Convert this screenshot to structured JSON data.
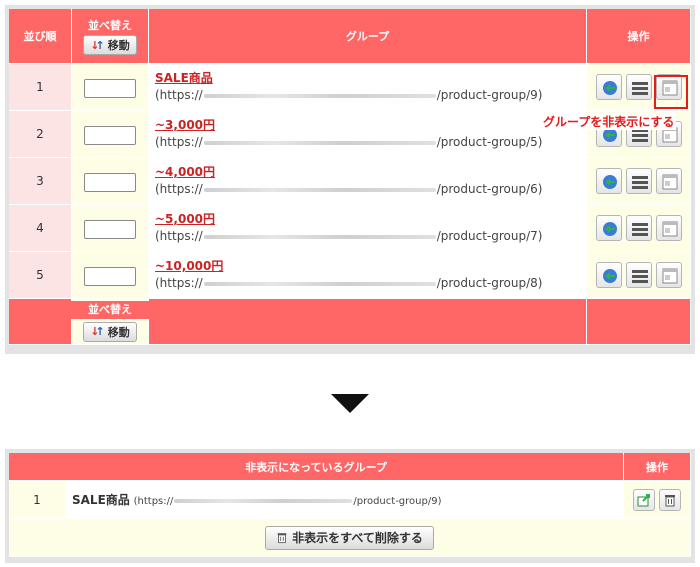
{
  "top_table": {
    "headers": {
      "order": "並び順",
      "sort": "並べ替え",
      "group": "グループ",
      "actions": "操作"
    },
    "move_button_label": "移動",
    "rows": [
      {
        "num": "1",
        "name": "SALE商品",
        "url_prefix": "(https://",
        "url_suffix": "/product-group/9)"
      },
      {
        "num": "2",
        "name": "~3,000円",
        "url_prefix": "(https://",
        "url_suffix": "/product-group/5)"
      },
      {
        "num": "3",
        "name": "~4,000円",
        "url_prefix": "(https://",
        "url_suffix": "/product-group/6)"
      },
      {
        "num": "4",
        "name": "~5,000円",
        "url_prefix": "(https://",
        "url_suffix": "/product-group/7)"
      },
      {
        "num": "5",
        "name": "~10,000円",
        "url_prefix": "(https://",
        "url_suffix": "/product-group/8)"
      }
    ],
    "footer_sort_label": "並べ替え",
    "icons": [
      "refresh-icon",
      "list-icon",
      "window-icon"
    ]
  },
  "annotation": {
    "callout": "グループを非表示にする"
  },
  "bottom_table": {
    "headers": {
      "hidden_groups": "非表示になっているグループ",
      "actions": "操作"
    },
    "rows": [
      {
        "num": "1",
        "name": "SALE商品",
        "url_prefix": "(https://",
        "url_suffix": "/product-group/9)"
      }
    ],
    "delete_all_label": "非表示をすべて削除する",
    "icons": [
      "restore-icon",
      "trash-icon"
    ]
  },
  "colors": {
    "header_red": "#ff6666",
    "number_cell_pink": "#fde4e4",
    "cream": "#fefde6",
    "link_red": "#cc2222",
    "annotation_red": "#e31c1c"
  }
}
